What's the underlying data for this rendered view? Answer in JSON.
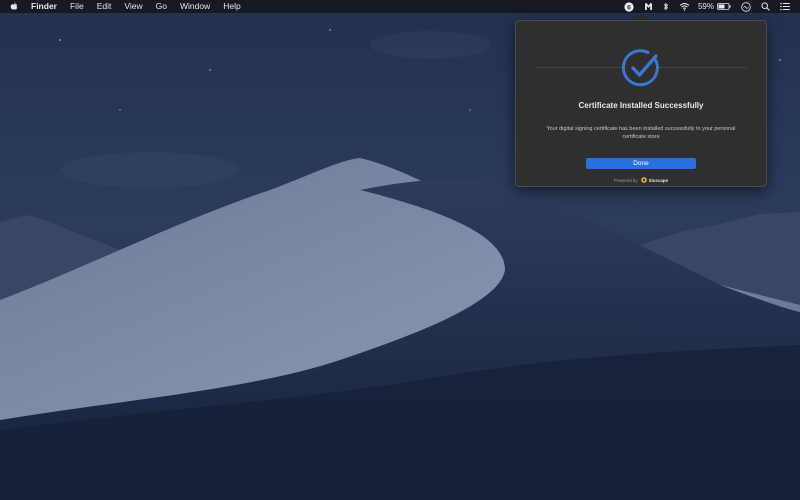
{
  "menubar": {
    "app_name": "Finder",
    "menus": [
      "File",
      "Edit",
      "View",
      "Go",
      "Window",
      "Help"
    ],
    "battery_percent": "59%",
    "icons": [
      "apple-icon",
      "app-badge-icon",
      "malwarebytes-icon",
      "bluetooth-icon",
      "wifi-icon",
      "battery-icon",
      "siri-icon",
      "search-icon",
      "notification-center-icon"
    ]
  },
  "popover": {
    "title": "Certificate Installed Successfully",
    "message": "Your digital signing certificate has been installed successfully to your personal certificate store",
    "done_label": "Done",
    "powered_by_label": "Powered by",
    "brand_name": "Sixscape",
    "accent_color": "#2a6fe0"
  },
  "colors": {
    "menubar_bg": "#16181f",
    "popover_bg": "#2f2f30",
    "check_color": "#3a78d6"
  }
}
